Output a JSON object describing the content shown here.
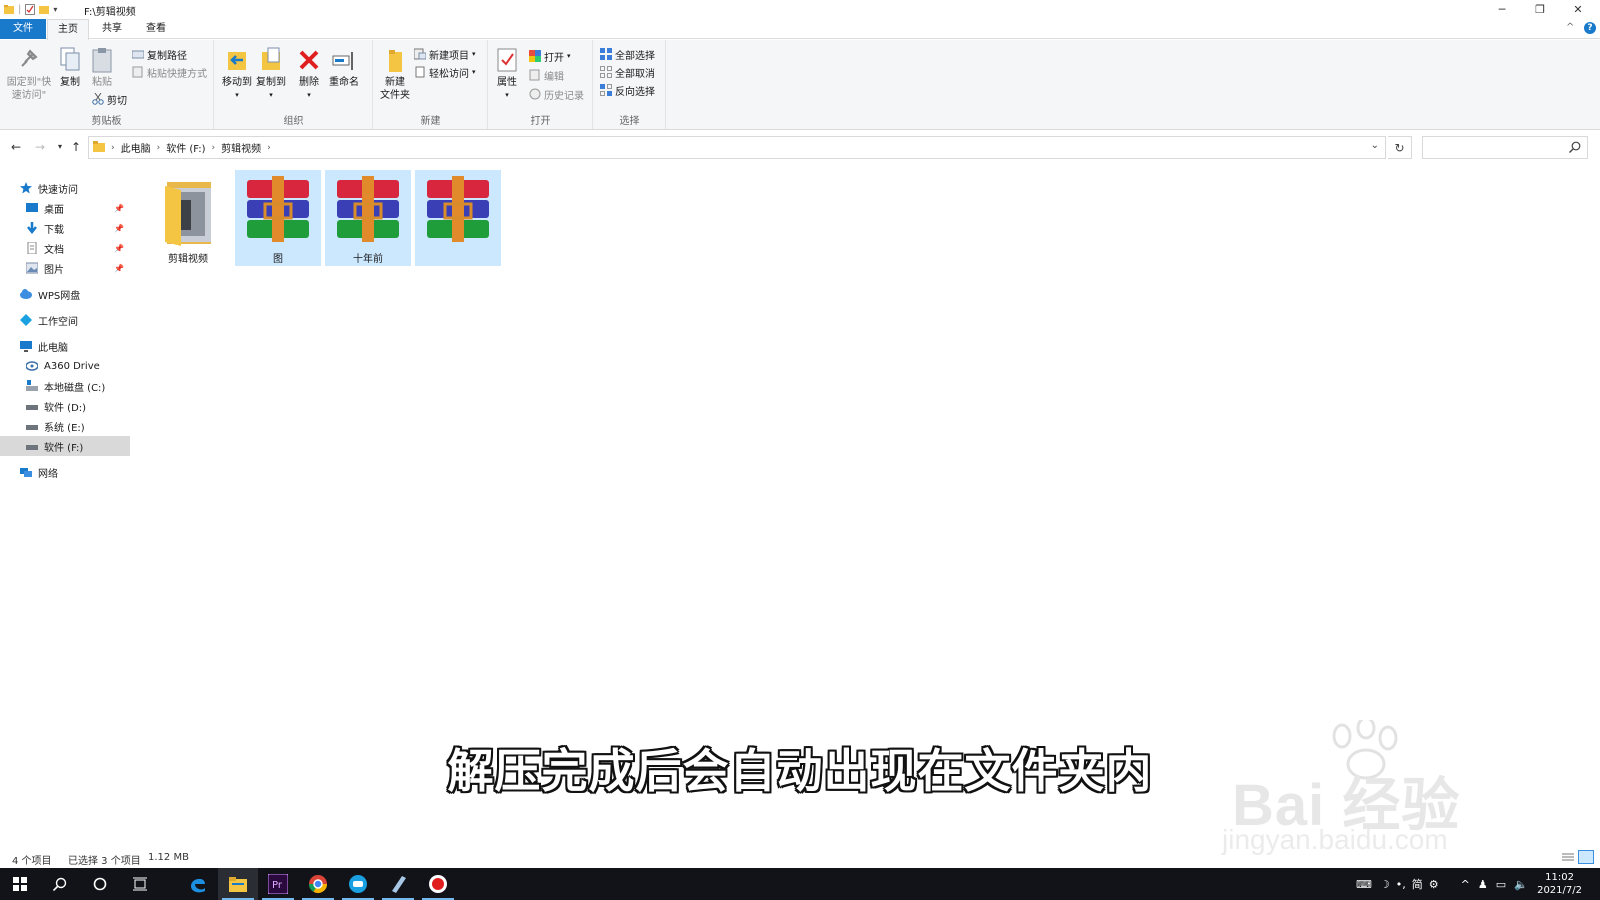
{
  "window": {
    "title": "F:\\剪辑视频"
  },
  "tabs": {
    "file": "文件",
    "home": "主页",
    "share": "共享",
    "view": "查看"
  },
  "ribbon": {
    "clipboard": {
      "label": "剪贴板",
      "pin": "固定到\"快\n速访问\"",
      "copy": "复制",
      "paste": "粘贴",
      "copy_path": "复制路径",
      "paste_shortcut": "粘贴快捷方式",
      "cut": "剪切"
    },
    "organize": {
      "label": "组织",
      "move_to": "移动到",
      "copy_to": "复制到",
      "delete": "删除",
      "rename": "重命名"
    },
    "new": {
      "label": "新建",
      "new_folder": "新建\n文件夹",
      "new_item": "新建项目",
      "easy_access": "轻松访问"
    },
    "open": {
      "label": "打开",
      "properties": "属性",
      "open": "打开",
      "edit": "编辑",
      "history": "历史记录"
    },
    "select": {
      "label": "选择",
      "select_all": "全部选择",
      "select_none": "全部取消",
      "invert": "反向选择"
    }
  },
  "address": {
    "crumbs": [
      "此电脑",
      "软件 (F:)",
      "剪辑视频"
    ],
    "search_placeholder": ""
  },
  "nav": {
    "quick_access": "快速访问",
    "desktop": "桌面",
    "downloads": "下载",
    "documents": "文档",
    "pictures": "图片",
    "wps": "WPS网盘",
    "workspace": "工作空间",
    "this_pc": "此电脑",
    "a360": "A360 Drive",
    "drive_c": "本地磁盘 (C:)",
    "drive_d": "软件 (D:)",
    "drive_e": "系统 (E:)",
    "drive_f": "软件 (F:)",
    "network": "网络"
  },
  "files": [
    {
      "name": "剪辑视频",
      "type": "folder",
      "selected": false
    },
    {
      "name": "图",
      "type": "rar",
      "selected": true
    },
    {
      "name": "十年前",
      "type": "rar",
      "selected": true
    },
    {
      "name": "",
      "type": "rar",
      "selected": true
    }
  ],
  "status": {
    "count": "4 个项目",
    "selection": "已选择 3 个项目",
    "size": "1.12 MB"
  },
  "overlay": {
    "subtitle": "解压完成后会自动出现在文件夹内",
    "watermark_logo": "Bai 经验",
    "watermark_url": "jingyan.baidu.com"
  },
  "taskbar": {
    "tray_ime": "简",
    "time": "11:02",
    "date": "2021/7/2"
  },
  "colors": {
    "accent": "#1979ca",
    "selection": "#cce8ff",
    "taskbar": "#111318"
  }
}
